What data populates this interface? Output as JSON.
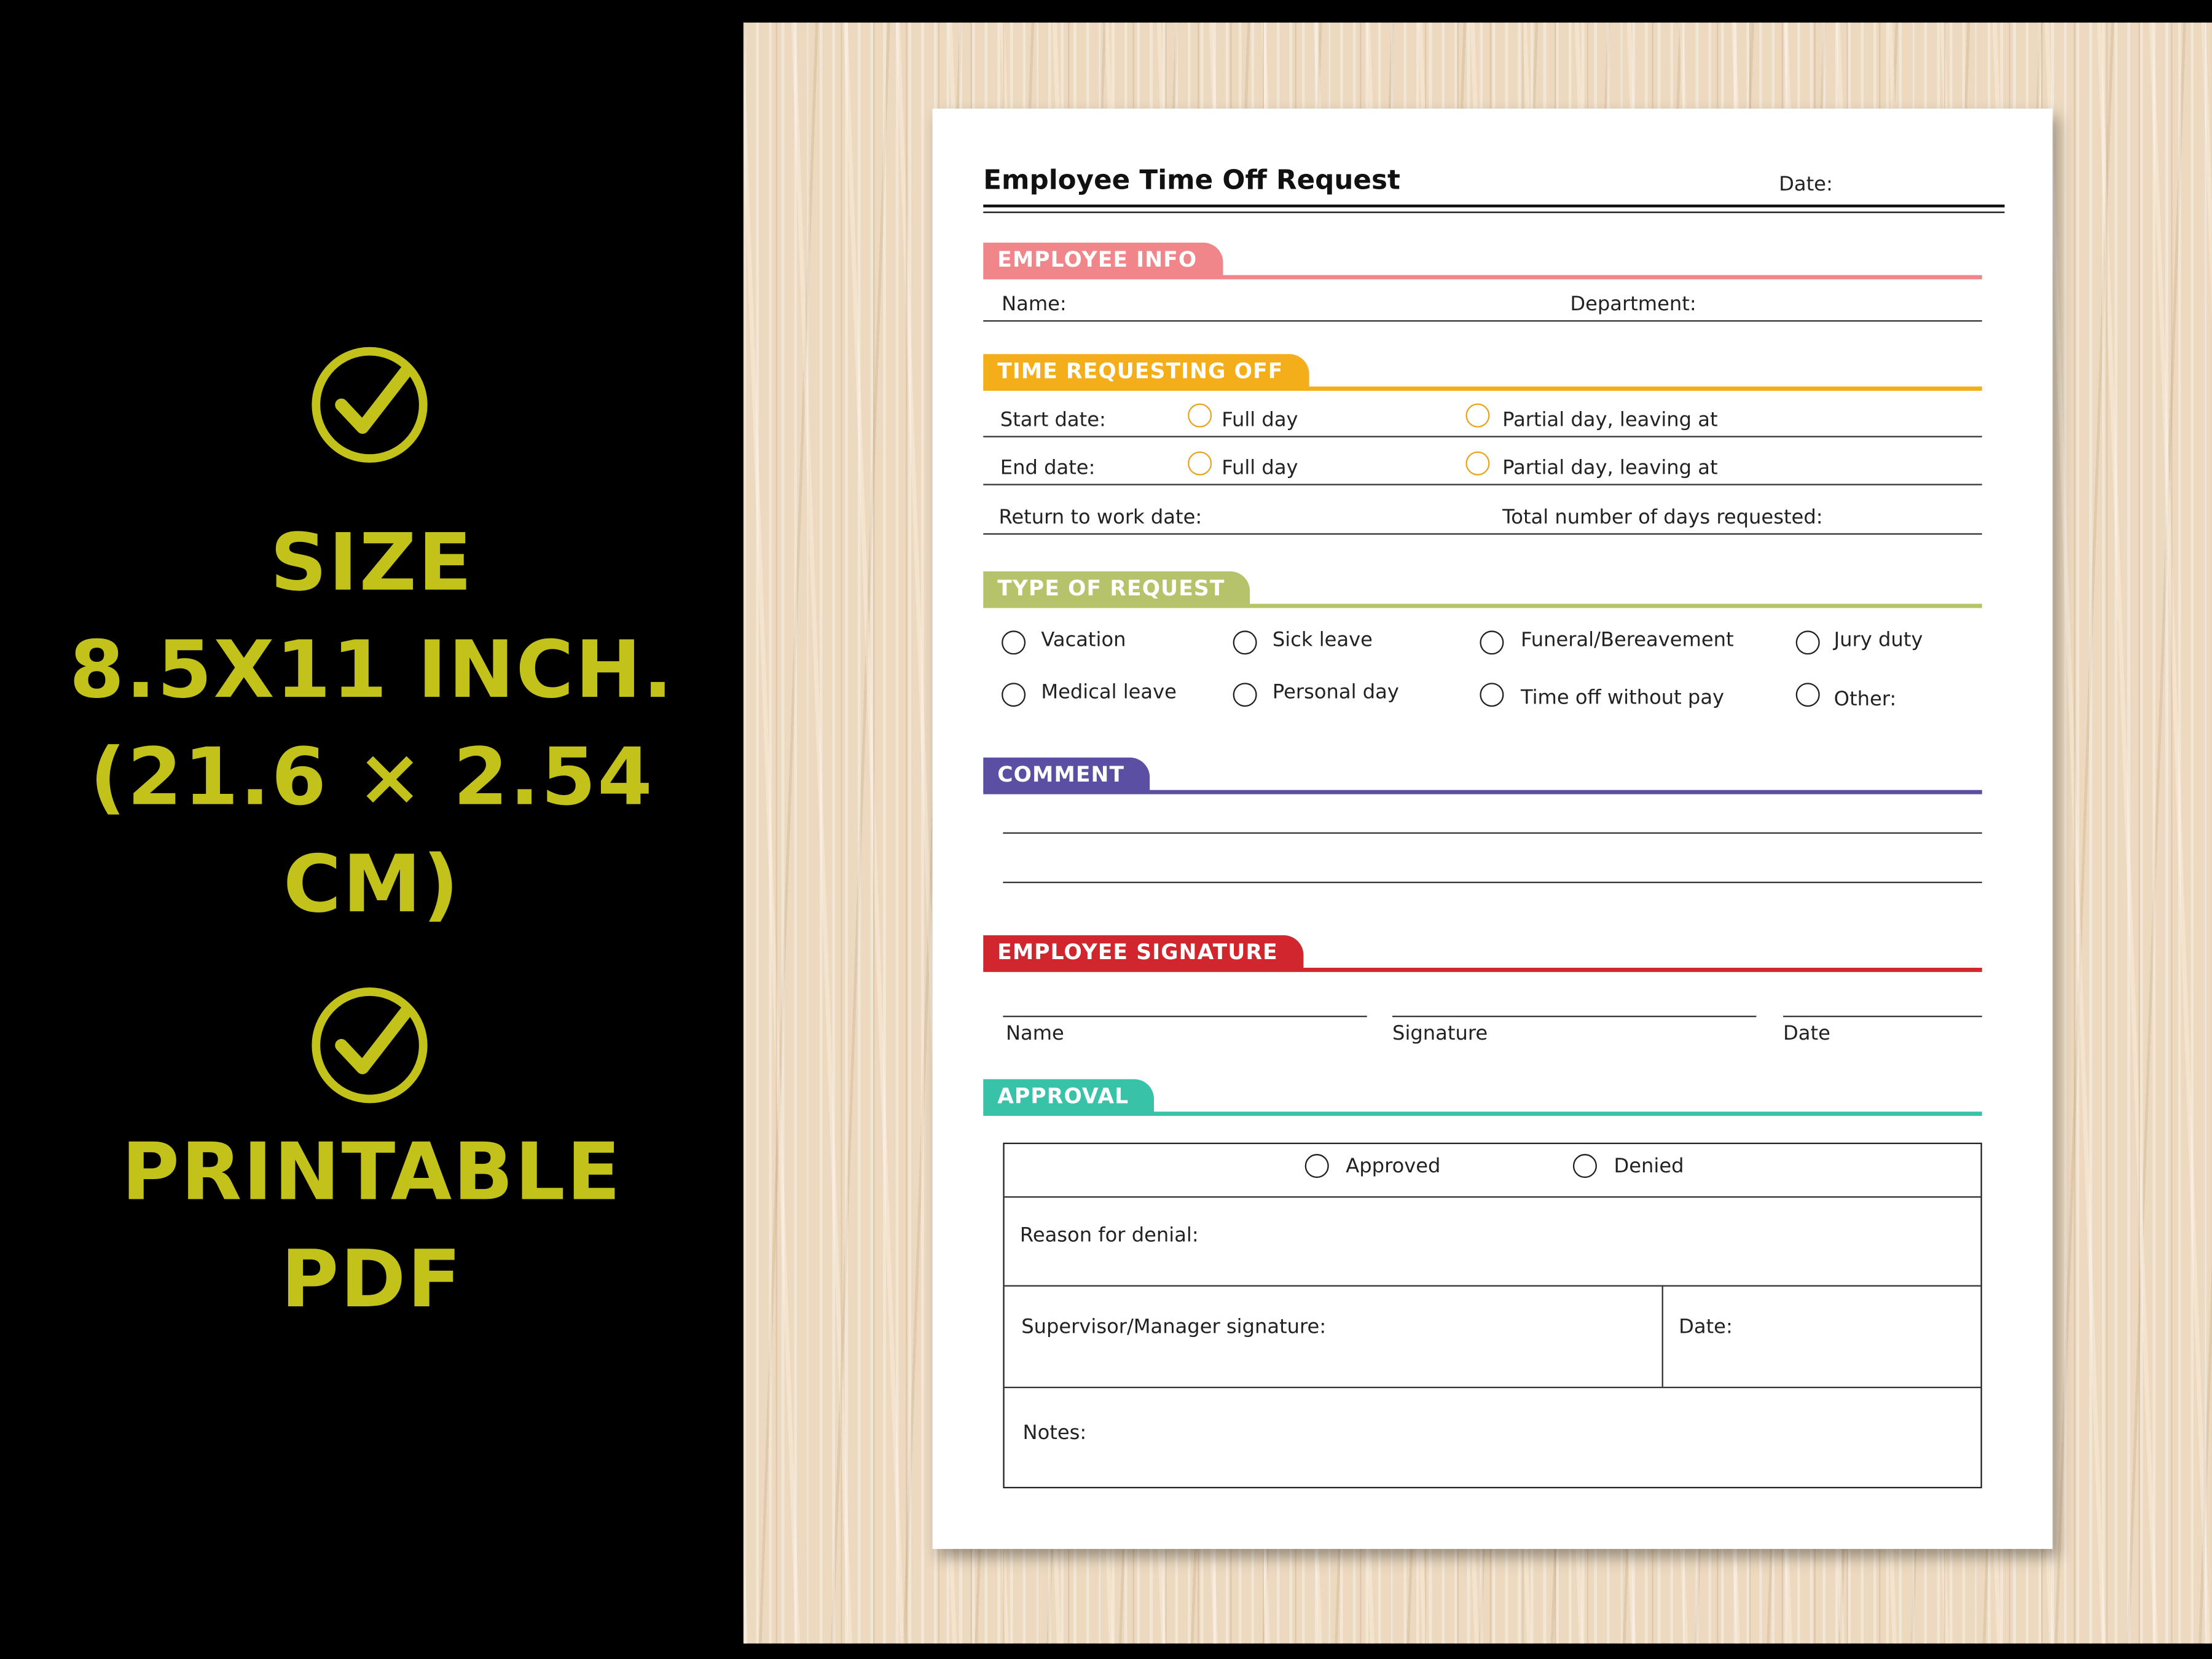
{
  "promo": {
    "accent_color": "#c3c21a",
    "icon": "check-circle-icon",
    "size_lines": [
      "SIZE",
      "8.5X11 INCH.",
      "(21.6 × 2.54 CM)"
    ],
    "printable_lines": [
      "PRINTABLE",
      "PDF"
    ]
  },
  "form": {
    "title": "Employee Time Off Request",
    "date_label": "Date:",
    "employee_info": {
      "heading": "EMPLOYEE INFO",
      "color": "#f0858a",
      "name_label": "Name:",
      "department_label": "Department:"
    },
    "time_off": {
      "heading": "TIME REQUESTING OFF",
      "color": "#f4ae1a",
      "start_label": "Start date:",
      "end_label": "End date:",
      "full_day": "Full day",
      "partial_day": "Partial day, leaving at",
      "return_label": "Return to work date:",
      "total_label": "Total number of days requested:"
    },
    "type_of_request": {
      "heading": "TYPE OF REQUEST",
      "color": "#b7c36b",
      "options": [
        "Vacation",
        "Sick leave",
        "Funeral/Bereavement",
        "Jury duty",
        "Medical leave",
        "Personal day",
        "Time off without pay",
        "Other:"
      ]
    },
    "comment": {
      "heading": "COMMENT",
      "color": "#5a4fa3"
    },
    "signature": {
      "heading": "EMPLOYEE SIGNATURE",
      "color": "#d2262f",
      "name": "Name",
      "signature": "Signature",
      "date": "Date"
    },
    "approval": {
      "heading": "APPROVAL",
      "color": "#38c3a8",
      "approved": "Approved",
      "denied": "Denied",
      "reason": "Reason for denial:",
      "supervisor": "Supervisor/Manager signature:",
      "date": "Date:",
      "notes": "Notes:"
    }
  }
}
